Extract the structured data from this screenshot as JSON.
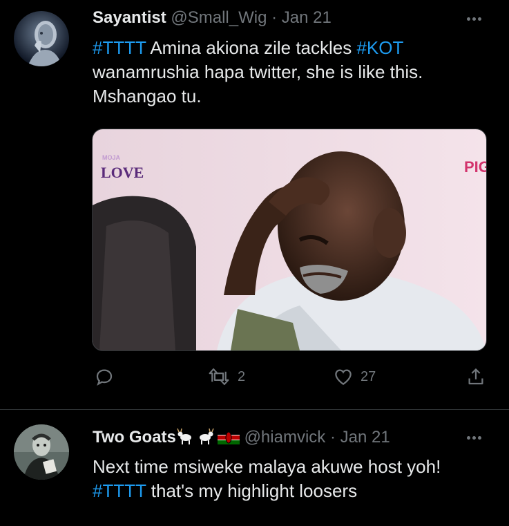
{
  "tweets": [
    {
      "display_name": "Sayantist",
      "handle": "@Small_Wig",
      "date": "Jan 21",
      "separator": "·",
      "text_parts": [
        {
          "text": "#TTTT",
          "type": "hashtag"
        },
        {
          "text": " Amina akiona zile tackles ",
          "type": "text"
        },
        {
          "text": "#KOT",
          "type": "hashtag"
        }
      ],
      "text_line2": "wanamrushia hapa twitter, she is like this.",
      "text_line3": "Mshangao tu.",
      "media": {
        "watermark_top": "MOJA",
        "watermark_bottom": "LOVE",
        "watermark_right": "PIG"
      },
      "replies_count": "",
      "retweets_count": "2",
      "likes_count": "27",
      "avatar_icon": "robot-avatar"
    },
    {
      "display_name": "Two Goats",
      "name_emojis": [
        "goat-emoji",
        "goat-emoji",
        "kenya-flag-emoji"
      ],
      "handle": "@hiamvick",
      "date": "Jan 21",
      "separator": "·",
      "text_line1": "Next time msiweke malaya akuwe host yoh!",
      "text_line2_tag": "#TTTT",
      "text_line2_rest": " that's my highlight loosers",
      "avatar_icon": "zombie-avatar"
    }
  ],
  "colors": {
    "background": "#000000",
    "text": "#e7e9ea",
    "muted": "#71767b",
    "link": "#1d9bf0",
    "divider": "#2f3336"
  }
}
